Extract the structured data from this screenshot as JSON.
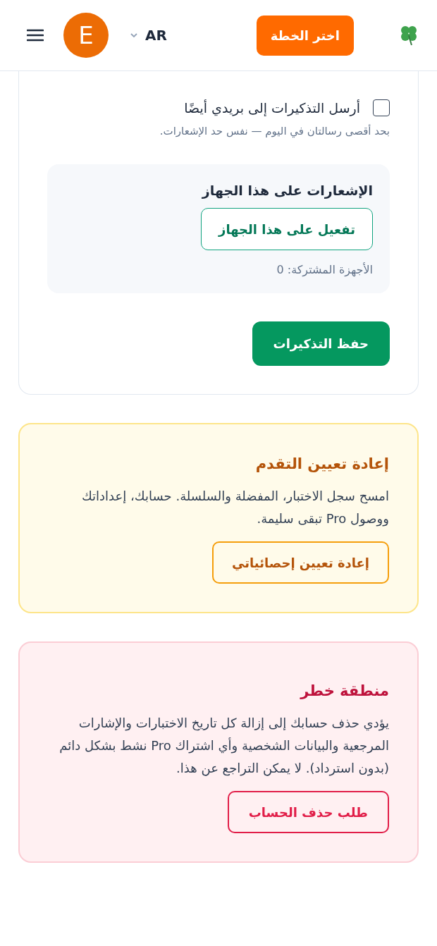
{
  "header": {
    "avatar_letter": "E",
    "language": "AR",
    "plan_button": "اختر الخطة"
  },
  "reminders": {
    "email_option": {
      "label": "أرسل التذكيرات إلى بريدي أيضًا",
      "checked": false
    },
    "hint": "بحد أقصى رسالتان في اليوم — نفس حد الإشعارات.",
    "device": {
      "title": "الإشعارات على هذا الجهاز",
      "button": "تفعيل على هذا الجهاز",
      "count": "الأجهزة المشتركة: 0"
    },
    "save_button": "حفظ التذكيرات"
  },
  "reset": {
    "title": "إعادة تعيين التقدم",
    "body": "امسح سجل الاختبار، المفضلة والسلسلة. حسابك، إعداداتك ووصول Pro تبقى سليمة.",
    "button": "إعادة تعيين إحصائياتي"
  },
  "danger": {
    "title": "منطقة خطر",
    "body": "يؤدي حذف حسابك إلى إزالة كل تاريخ الاختبارات والإشارات المرجعية والبيانات الشخصية وأي اشتراك Pro نشط بشكل دائم (بدون استرداد). لا يمكن التراجع عن هذا.",
    "button": "طلب حذف الحساب"
  }
}
